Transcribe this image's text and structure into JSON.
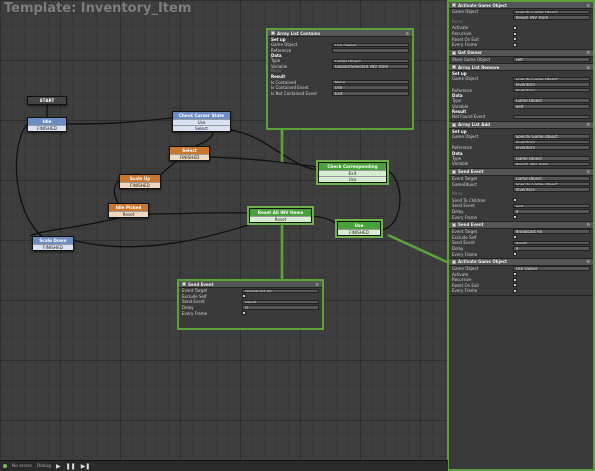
{
  "title": "Template: Inventory_Item",
  "states": {
    "start": {
      "label": "START"
    },
    "idle": {
      "label": "Idle",
      "event": "FINISHED"
    },
    "check_cursor": {
      "label": "Check Cursor State",
      "events": [
        "Use",
        "Select"
      ]
    },
    "select": {
      "label": "Select",
      "event": "FINISHED"
    },
    "scale_up": {
      "label": "Scale Up",
      "event": "FINISHED"
    },
    "idle_picked": {
      "label": "Idle Picked",
      "event": "Reset"
    },
    "scale_down": {
      "label": "Scale Down",
      "event": "FINISHED"
    },
    "reset_all": {
      "label": "Reset All INV Items",
      "event": "Reset"
    },
    "check_corr": {
      "label": "Check Corresponding",
      "events": [
        "Exit",
        "Use"
      ]
    },
    "use": {
      "label": "Use",
      "event": "FINISHED"
    }
  },
  "array_panel": {
    "title": "Array List Contains",
    "setup": "Set up",
    "rows": [
      {
        "l": "Game Object",
        "v": "Use Owner"
      },
      {
        "l": "Reference",
        "v": ""
      }
    ],
    "data": "Data",
    "data_rows": [
      {
        "l": "Type",
        "v": "Game Object"
      },
      {
        "l": "Variable",
        "v": "Globals/Selected_INV_Item"
      }
    ],
    "none": "None",
    "result": "Result",
    "result_rows": [
      {
        "l": "Is Contained",
        "v": "None"
      },
      {
        "l": "Is Contained Event",
        "v": "Use"
      },
      {
        "l": "Is Not Contained Event",
        "v": "Exit"
      }
    ]
  },
  "send_panel": {
    "title": "Send Event",
    "rows": [
      {
        "l": "Event Target",
        "v": "Broadcast All"
      },
      {
        "l": "Exclude Self",
        "v": "chk"
      },
      {
        "l": "Send Event",
        "v": "Reset"
      },
      {
        "l": "Delay",
        "v": "0"
      },
      {
        "l": "Every Frame",
        "v": "chk"
      }
    ]
  },
  "inspector": [
    {
      "title": "Activate Game Object",
      "rows": [
        {
          "l": "Game Object",
          "v": "Specify Game Object"
        },
        {
          "l": "",
          "v": "Result_INV_Item"
        },
        {
          "l": "None",
          "v": "none"
        },
        {
          "l": "Activate",
          "v": "chk"
        },
        {
          "l": "Recursive",
          "v": "chk"
        },
        {
          "l": "Reset On Exit",
          "v": "chk"
        },
        {
          "l": "Every Frame",
          "v": "chk"
        }
      ]
    },
    {
      "title": "Get Owner",
      "rows": [
        {
          "l": "Store Game Object",
          "v": "self"
        }
      ]
    },
    {
      "title": "Array List Remove",
      "rows": [
        {
          "l": "Set up",
          "v": "sec"
        },
        {
          "l": "Game Object",
          "v": "Specify Game Object"
        },
        {
          "l": "",
          "v": "Inventory"
        },
        {
          "l": "Reference",
          "v": "Inventory"
        },
        {
          "l": "Data",
          "v": "sec"
        },
        {
          "l": "Type",
          "v": "Game Object"
        },
        {
          "l": "Variable",
          "v": "Self"
        },
        {
          "l": "Result",
          "v": "sec"
        },
        {
          "l": "Not Found Event",
          "v": ""
        }
      ]
    },
    {
      "title": "Array List Add",
      "rows": [
        {
          "l": "Set up",
          "v": "sec"
        },
        {
          "l": "Game Object",
          "v": "Specify Game Object"
        },
        {
          "l": "",
          "v": "Inventory"
        },
        {
          "l": "Reference",
          "v": "Inventory"
        },
        {
          "l": "Data",
          "v": "sec"
        },
        {
          "l": "Type",
          "v": "Game Object"
        },
        {
          "l": "Variable",
          "v": "Result_INV_Item"
        }
      ]
    },
    {
      "title": "Send Event",
      "rows": [
        {
          "l": "Event Target",
          "v": "Game Object"
        },
        {
          "l": "GameObject",
          "v": "Specify Game Object"
        },
        {
          "l": "",
          "v": "Inventory"
        },
        {
          "l": "None",
          "v": "none"
        },
        {
          "l": "Send To Children",
          "v": "chk"
        },
        {
          "l": "Send Event",
          "v": "Sell"
        },
        {
          "l": "Delay",
          "v": "0"
        },
        {
          "l": "Every Frame",
          "v": "chk"
        }
      ]
    },
    {
      "title": "Send Event",
      "rows": [
        {
          "l": "Event Target",
          "v": "Broadcast All"
        },
        {
          "l": "Exclude Self",
          "v": "chk"
        },
        {
          "l": "Send Event",
          "v": "Reset"
        },
        {
          "l": "Delay",
          "v": "0"
        },
        {
          "l": "Every Frame",
          "v": "chk"
        }
      ]
    },
    {
      "title": "Activate Game Object",
      "rows": [
        {
          "l": "Game Object",
          "v": "Use Owner"
        },
        {
          "l": "Activate",
          "v": "chk"
        },
        {
          "l": "Recursive",
          "v": "chk"
        },
        {
          "l": "Reset On Exit",
          "v": "chk"
        },
        {
          "l": "Every Frame",
          "v": "chk"
        }
      ]
    }
  ],
  "statusbar": {
    "errors": "No errors",
    "debug": "Debug",
    "play": "▶",
    "pause": "❚❚",
    "step": "▶❚"
  }
}
